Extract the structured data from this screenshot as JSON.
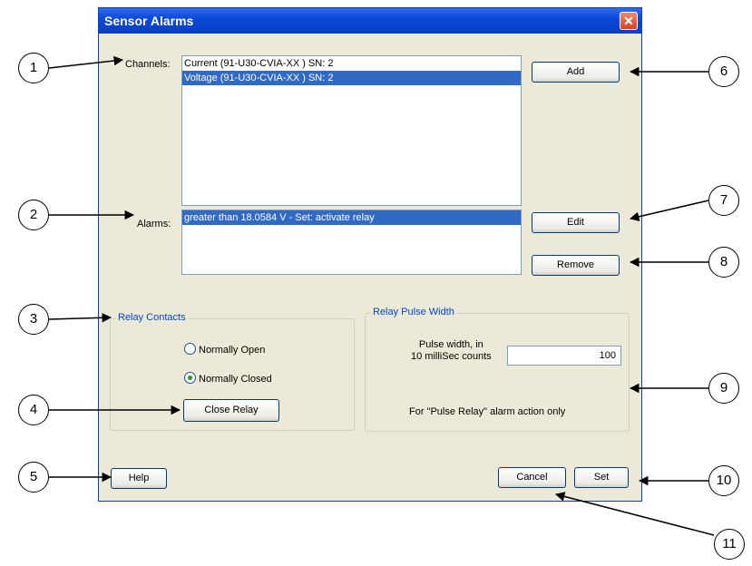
{
  "window": {
    "title": "Sensor Alarms",
    "close_symbol": "✕",
    "close_icon": "close-icon"
  },
  "channels": {
    "label": "Channels:",
    "items": [
      {
        "text": "Current (91-U30-CVIA-XX ) SN: 2",
        "selected": false
      },
      {
        "text": "Voltage (91-U30-CVIA-XX ) SN: 2",
        "selected": true
      }
    ]
  },
  "alarms": {
    "label": "Alarms:",
    "items": [
      {
        "text": "greater than 18.0584 V - Set: activate relay",
        "selected": true
      }
    ]
  },
  "buttons": {
    "add": "Add",
    "edit": "Edit",
    "remove": "Remove",
    "close_relay": "Close Relay",
    "help": "Help",
    "cancel": "Cancel",
    "set": "Set"
  },
  "relay_contacts": {
    "title": "Relay Contacts",
    "options": [
      {
        "label": "Normally Open",
        "checked": false
      },
      {
        "label": "Normally Closed",
        "checked": true
      }
    ]
  },
  "relay_pulse_width": {
    "title": "Relay Pulse Width",
    "field_label_line1": "Pulse width, in",
    "field_label_line2": "10 milliSec counts",
    "value": "100",
    "note": "For \"Pulse Relay\" alarm action only"
  },
  "callouts": [
    "1",
    "2",
    "3",
    "4",
    "5",
    "6",
    "7",
    "8",
    "9",
    "10",
    "11"
  ],
  "colors": {
    "titlebar": "#0b48d9",
    "dialog_bg": "#ece9d8",
    "selection": "#316ac5",
    "group_title": "#0046d5"
  }
}
